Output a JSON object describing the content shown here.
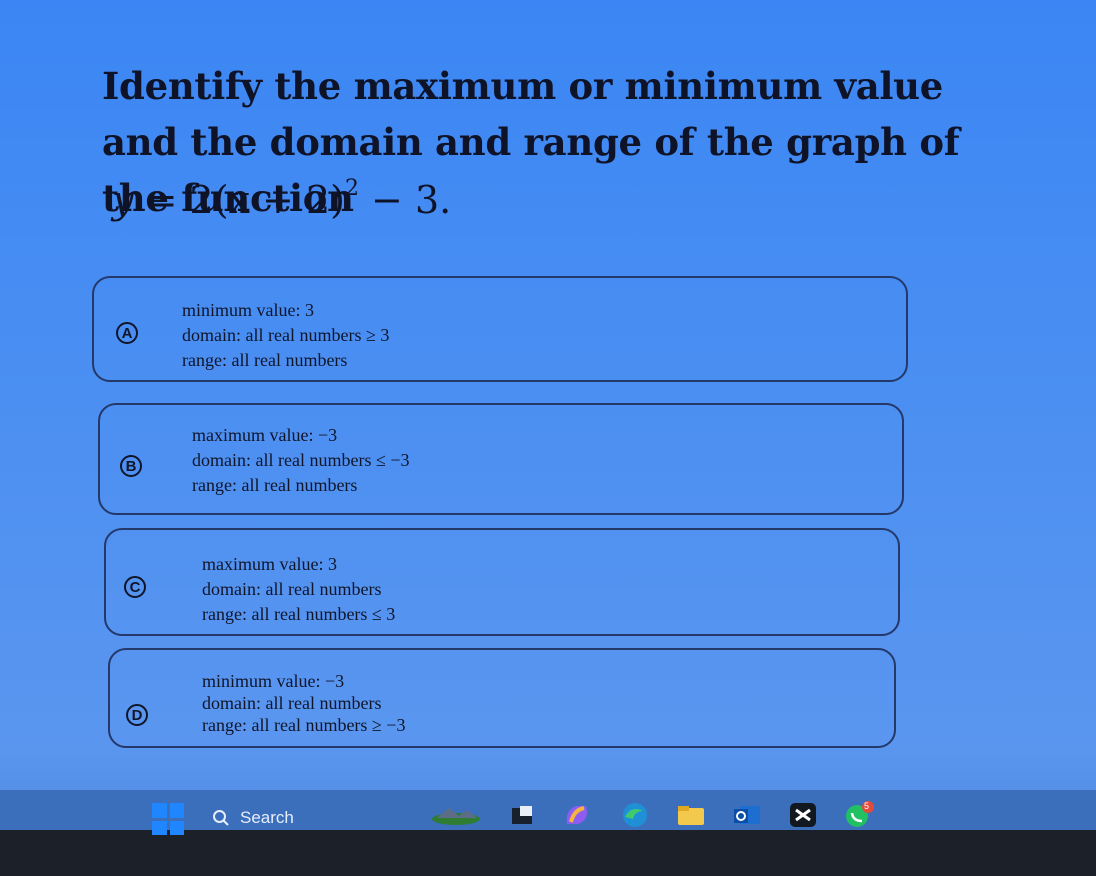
{
  "question": {
    "text": "Identify the maximum or minimum value and the domain and range of the graph of the function",
    "equation": {
      "lhs": "y",
      "equals": "=",
      "coef": "2",
      "inner": "(x + 2)",
      "exponent": "2",
      "tail": "− 3."
    }
  },
  "options": [
    {
      "letter": "A",
      "line1": "minimum value: 3",
      "line2": "domain: all real numbers ≥ 3",
      "line3": "range: all real numbers"
    },
    {
      "letter": "B",
      "line1": "maximum value: −3",
      "line2": "domain: all real numbers ≤ −3",
      "line3": "range: all real numbers"
    },
    {
      "letter": "C",
      "line1": "maximum value: 3",
      "line2": "domain: all real numbers",
      "line3": "range: all real numbers ≤ 3"
    },
    {
      "letter": "D",
      "line1": "minimum value: −3",
      "line2": "domain: all real numbers",
      "line3": "range: all real numbers ≥ −3"
    }
  ],
  "taskbar": {
    "search_label": "Search",
    "badge": "5",
    "icons": [
      "windows-start-icon",
      "search-icon",
      "landscape-widget-icon",
      "task-view-icon",
      "copilot-icon",
      "edge-browser-icon",
      "file-explorer-icon",
      "outlook-icon",
      "capcut-icon",
      "whatsapp-icon"
    ]
  }
}
